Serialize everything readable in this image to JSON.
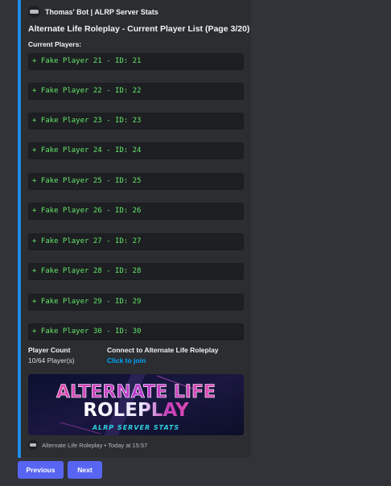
{
  "embed": {
    "accent_color": "#1f8be8",
    "author": "Thomas' Bot | ALRP Server Stats",
    "author_icon": "bot-logo-icon",
    "title": "Alternate Life Roleplay - Current Player List (Page 3/20)",
    "players_header": "Current Players:",
    "players": [
      "+ Fake Player 21 - ID: 21",
      "+ Fake Player 22 - ID: 22",
      "+ Fake Player 23 - ID: 23",
      "+ Fake Player 24 - ID: 24",
      "+ Fake Player 25 - ID: 25",
      "+ Fake Player 26 - ID: 26",
      "+ Fake Player 27 - ID: 27",
      "+ Fake Player 28 - ID: 28",
      "+ Fake Player 29 - ID: 29",
      "+ Fake Player 30 - ID: 30"
    ],
    "fields": {
      "player_count_label": "Player Count",
      "player_count_value": "10/64 Player(s)",
      "connect_label": "Connect to Alternate Life Roleplay",
      "connect_link": "Click to join"
    },
    "banner": {
      "line1": "ALTERNATE LIFE",
      "line2": "ROLEPLAY",
      "subtitle": "ALRP SERVER STATS"
    },
    "footer": {
      "icon": "server-logo-icon",
      "text": "Alternate Life Roleplay • Today at 15:57"
    }
  },
  "buttons": {
    "previous": "Previous",
    "next": "Next",
    "color": "#5865f2"
  }
}
